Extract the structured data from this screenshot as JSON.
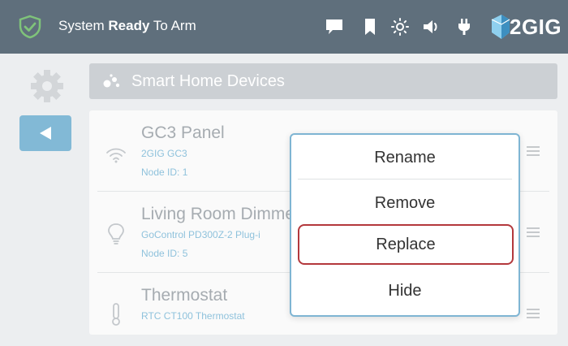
{
  "status_bar": {
    "status_prefix": "System ",
    "status_bold": "Ready",
    "status_suffix": " To Arm",
    "icons": [
      "shield-check-icon",
      "chat-icon",
      "bookmark-icon",
      "brightness-icon",
      "volume-icon",
      "power-plug-icon"
    ],
    "brand": "2GIG"
  },
  "header": {
    "title": "Smart Home Devices"
  },
  "devices": [
    {
      "name": "GC3 Panel",
      "model": "2GIG GC3",
      "node": "Node ID: 1",
      "icon": "wifi-icon"
    },
    {
      "name": "Living Room Dimme",
      "model": "GoControl PD300Z-2 Plug-i",
      "node": "Node ID: 5",
      "icon": "lightbulb-icon"
    },
    {
      "name": "Thermostat",
      "model": "RTC CT100 Thermostat",
      "node": "",
      "icon": "thermometer-icon"
    }
  ],
  "menu": {
    "options": [
      "Rename",
      "Remove",
      "Replace",
      "Hide"
    ],
    "selected": "Replace"
  },
  "colors": {
    "topbar": "#5f6f7c",
    "accent": "#82b9d6",
    "selected_border": "#b3383c",
    "shield": "#7fc37a"
  }
}
